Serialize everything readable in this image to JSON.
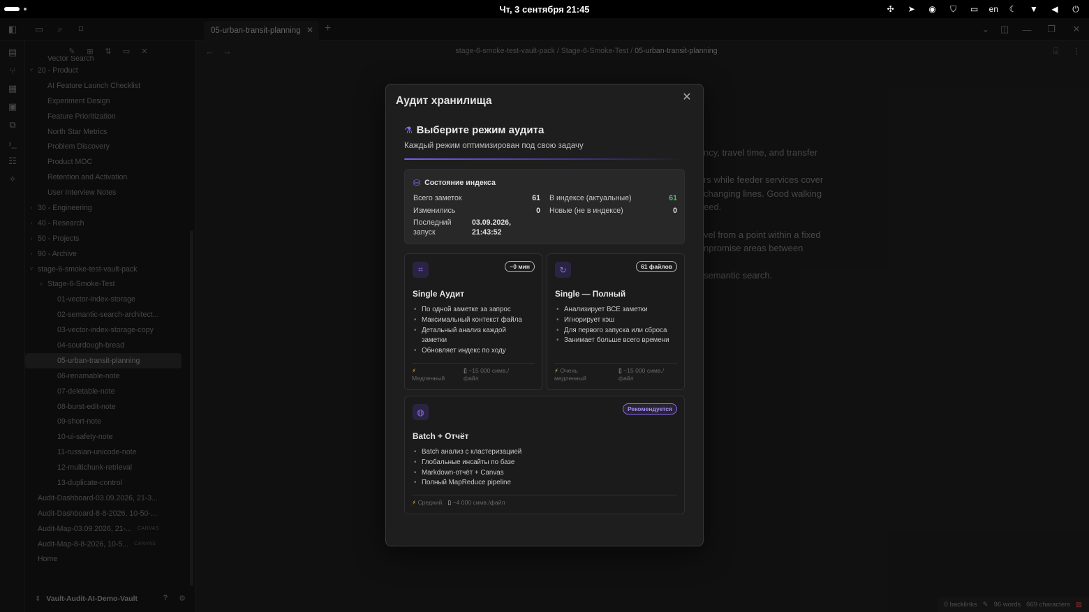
{
  "system": {
    "clock": "Чт, 3 сентября  21:45",
    "lang": "en"
  },
  "tabs": [
    {
      "label": "05-urban-transit-planning"
    }
  ],
  "breadcrumb": {
    "part1": "stage-6-smoke-test-vault-pack",
    "part2": "Stage-6-Smoke-Test",
    "current": "05-urban-transit-planning",
    "sep": "/"
  },
  "sidebar": {
    "tree": [
      {
        "label": "Vector Search",
        "indent": 2,
        "chevron": ""
      },
      {
        "label": "20 - Product",
        "indent": 1,
        "chevron": "˅"
      },
      {
        "label": "AI Feature Launch Checklist",
        "indent": 2,
        "chevron": ""
      },
      {
        "label": "Experiment Design",
        "indent": 2,
        "chevron": ""
      },
      {
        "label": "Feature Prioritization",
        "indent": 2,
        "chevron": ""
      },
      {
        "label": "North Star Metrics",
        "indent": 2,
        "chevron": ""
      },
      {
        "label": "Problem Discovery",
        "indent": 2,
        "chevron": ""
      },
      {
        "label": "Product MOC",
        "indent": 2,
        "chevron": ""
      },
      {
        "label": "Retention and Activation",
        "indent": 2,
        "chevron": ""
      },
      {
        "label": "User Interview Notes",
        "indent": 2,
        "chevron": ""
      },
      {
        "label": "30 - Engineering",
        "indent": 1,
        "chevron": "›"
      },
      {
        "label": "40 - Research",
        "indent": 1,
        "chevron": "›"
      },
      {
        "label": "50 - Projects",
        "indent": 1,
        "chevron": "›"
      },
      {
        "label": "90 - Archive",
        "indent": 1,
        "chevron": "›"
      },
      {
        "label": "stage-6-smoke-test-vault-pack",
        "indent": 1,
        "chevron": "˅"
      },
      {
        "label": "Stage-6-Smoke-Test",
        "indent": 2,
        "chevron": "˅"
      },
      {
        "label": "01-vector-index-storage",
        "indent": 3,
        "chevron": ""
      },
      {
        "label": "02-semantic-search-architect...",
        "indent": 3,
        "chevron": ""
      },
      {
        "label": "03-vector-index-storage-copy",
        "indent": 3,
        "chevron": ""
      },
      {
        "label": "04-sourdough-bread",
        "indent": 3,
        "chevron": ""
      },
      {
        "label": "05-urban-transit-planning",
        "indent": 3,
        "chevron": "",
        "active": true
      },
      {
        "label": "06-renamable-note",
        "indent": 3,
        "chevron": ""
      },
      {
        "label": "07-deletable-note",
        "indent": 3,
        "chevron": ""
      },
      {
        "label": "08-burst-edit-note",
        "indent": 3,
        "chevron": ""
      },
      {
        "label": "09-short-note",
        "indent": 3,
        "chevron": ""
      },
      {
        "label": "10-ui-safety-note",
        "indent": 3,
        "chevron": ""
      },
      {
        "label": "11-russian-unicode-note",
        "indent": 3,
        "chevron": ""
      },
      {
        "label": "12-multichunk-retrieval",
        "indent": 3,
        "chevron": ""
      },
      {
        "label": "13-duplicate-control",
        "indent": 3,
        "chevron": ""
      },
      {
        "label": "Audit-Dashboard-03.09.2026, 21-3...",
        "indent": 1,
        "chevron": ""
      },
      {
        "label": "Audit-Dashboard-8-8-2026, 10-50-...",
        "indent": 1,
        "chevron": ""
      },
      {
        "label": "Audit-Map-03.09.2026, 21-...",
        "indent": 1,
        "chevron": "",
        "tag": "CANVAS"
      },
      {
        "label": "Audit-Map-8-8-2026, 10-5...",
        "indent": 1,
        "chevron": "",
        "tag": "CANVAS"
      },
      {
        "label": "Home",
        "indent": 1,
        "chevron": ""
      }
    ],
    "vault_name": "Vault-Audit-AI-Demo-Vault"
  },
  "editor": {
    "lines": [
      "ncy, travel time, and transfer",
      "",
      "rs while feeder services cover",
      "changing lines. Good walking",
      "eed.",
      "",
      "vel from a point within a fixed",
      "npromise areas between",
      "",
      "semantic search."
    ]
  },
  "status": {
    "backlinks": "0 backlinks",
    "words": "96 words",
    "chars": "669 characters"
  },
  "modal": {
    "title": "Аудит хранилища",
    "heading": "Выберите режим аудита",
    "subtitle": "Каждый режим оптимизирован под свою задачу",
    "index": {
      "title": "Состояние индекса",
      "total_label": "Всего заметок",
      "total_value": "61",
      "changed_label": "Изменились",
      "changed_value": "0",
      "last_label_1": "Последний",
      "last_label_2": "запуск",
      "last_value_1": "03.09.2026,",
      "last_value_2": "21:43:52",
      "indexed_label": "В индексе (актуальные)",
      "indexed_value": "61",
      "new_label": "Новые (не в индексе)",
      "new_value": "0"
    },
    "cards": {
      "single": {
        "title": "Single Аудит",
        "badge": "~0 мин",
        "bullets": [
          "По одной заметке за запрос",
          "Максимальный контекст файла",
          "Детальный анализ каждой заметки",
          "Обновляет индекс по ходу"
        ],
        "speed_1": "Медленный",
        "size_1": "~15 000 симв./",
        "size_2": "файл"
      },
      "full": {
        "title": "Single — Полный",
        "badge": "61 файлов",
        "bullets": [
          "Анализирует ВСЕ заметки",
          "Игнорирует кэш",
          "Для первого запуска или сброса",
          "Занимает больше всего времени"
        ],
        "speed_1": "Очень",
        "speed_2": "медленный",
        "size_1": "~15 000 симв./",
        "size_2": "файл"
      },
      "batch": {
        "title": "Batch + Отчёт",
        "badge": "Рекомендуется",
        "bullets": [
          "Batch анализ с кластеризацией",
          "Глобальные инсайты по базе",
          "Markdown-отчёт + Canvas",
          "Полный MapReduce pipeline"
        ],
        "speed": "Средний",
        "size": "~4 000 симв./файл"
      }
    }
  },
  "colors": {
    "accent": "#8b6cf0",
    "green": "#4bbf6b",
    "bolt": "#e0b84a"
  }
}
